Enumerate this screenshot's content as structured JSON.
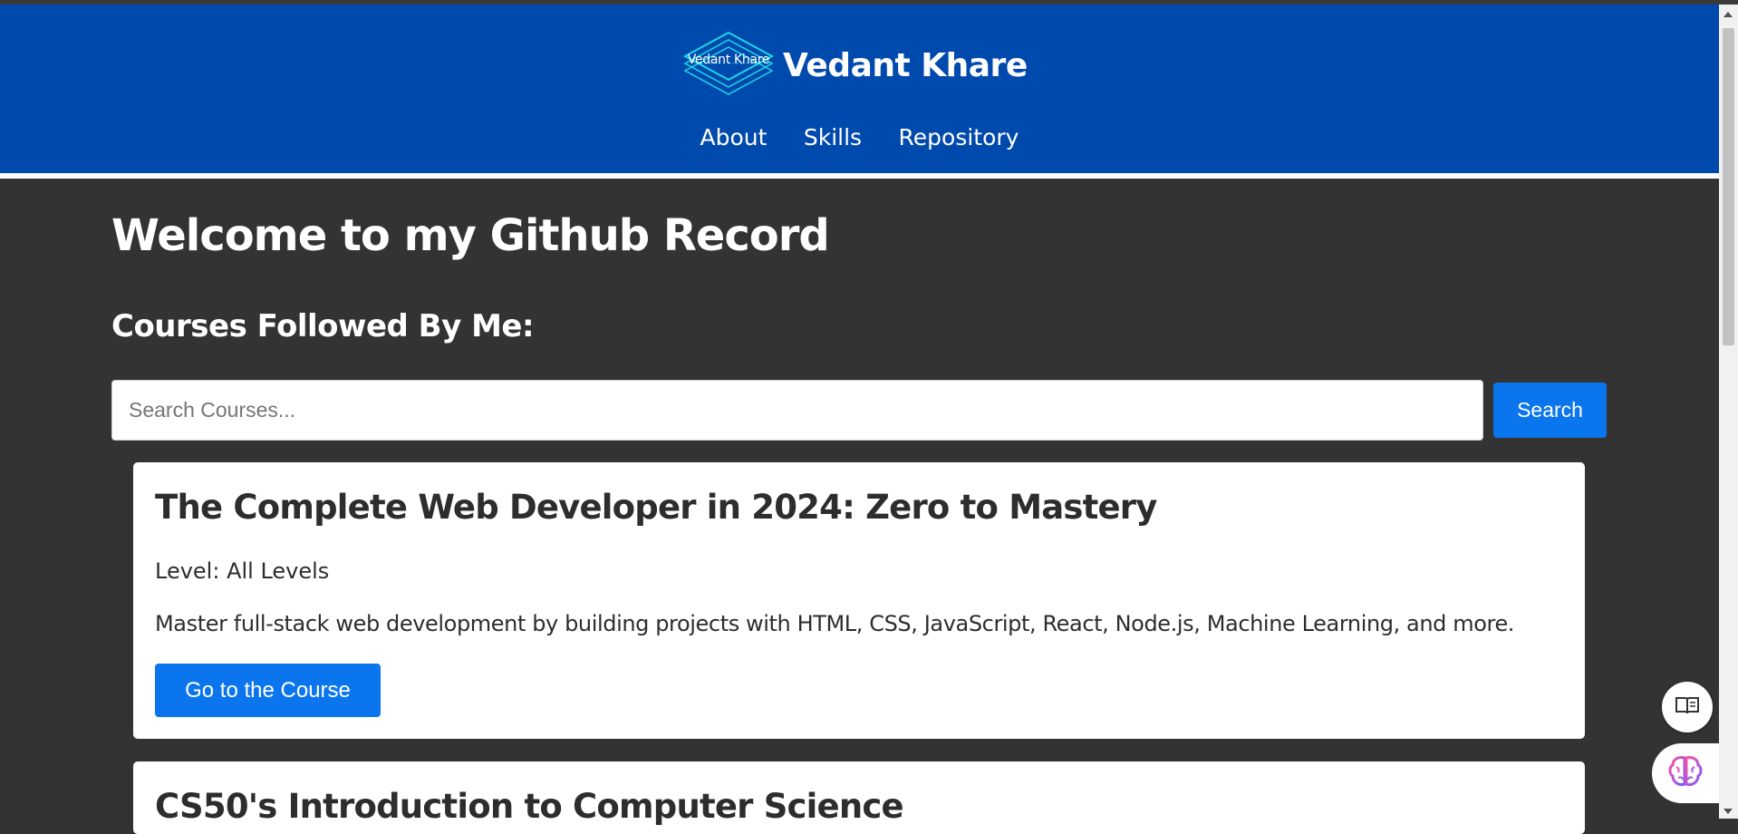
{
  "header": {
    "logo_text": "Vedant Khare",
    "title": "Vedant Khare",
    "nav": [
      {
        "label": "About"
      },
      {
        "label": "Skills"
      },
      {
        "label": "Repository"
      }
    ]
  },
  "main": {
    "page_title": "Welcome to my Github Record",
    "section_title": "Courses Followed By Me:",
    "search": {
      "placeholder": "Search Courses...",
      "value": "",
      "button_label": "Search"
    },
    "courses": [
      {
        "title": "The Complete Web Developer in 2024: Zero to Mastery",
        "level": "Level: All Levels",
        "description": "Master full-stack web development by building projects with HTML, CSS, JavaScript, React, Node.js, Machine Learning, and more.",
        "button_label": "Go to the Course"
      },
      {
        "title": "CS50's Introduction to Computer Science"
      }
    ]
  },
  "floating": {
    "reader_icon": "book-open-icon",
    "assistant_icon": "brain-icon"
  },
  "colors": {
    "header_bg": "#014aad",
    "page_bg": "#333333",
    "accent": "#0b75ee",
    "logo_stroke": "#1dd7e6"
  }
}
